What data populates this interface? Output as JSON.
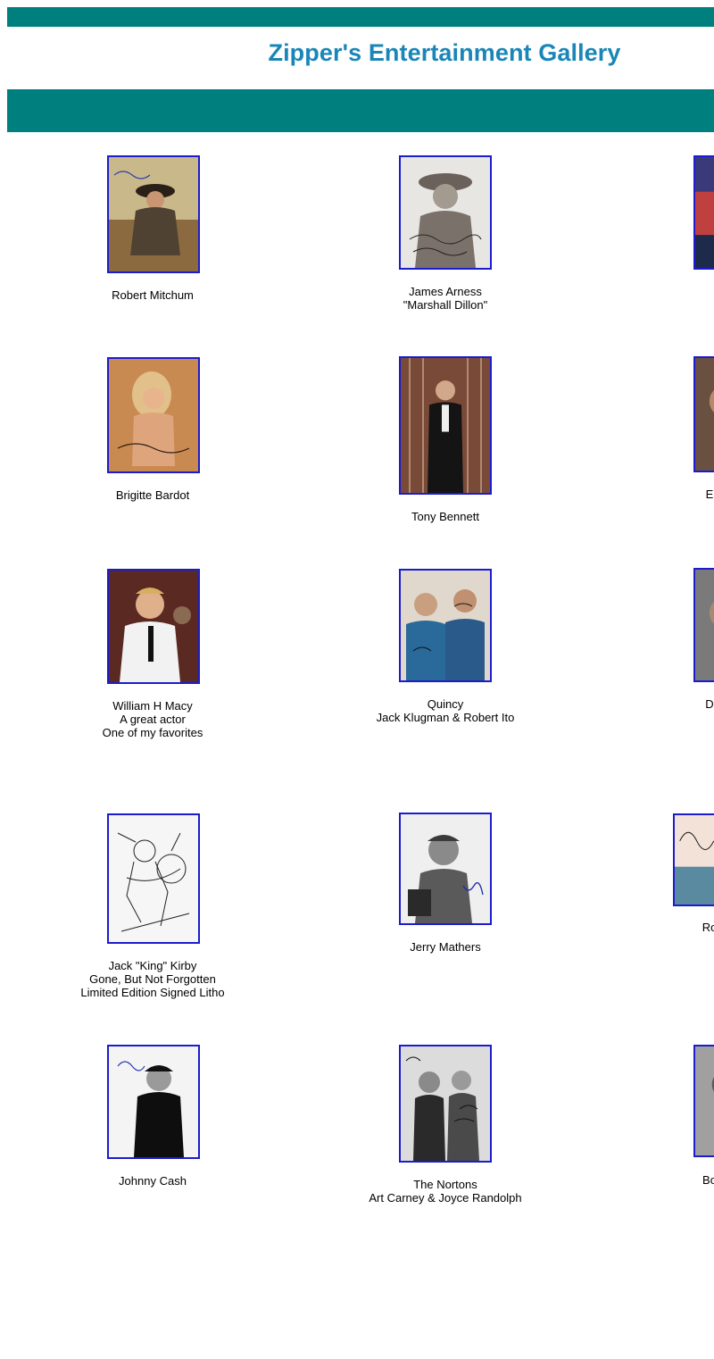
{
  "header": {
    "title": "Zipper's Entertainment Gallery"
  },
  "gallery": {
    "items": [
      {
        "caption": "Robert Mitchum"
      },
      {
        "caption": "James Arness\n\"Marshall Dillon\""
      },
      {
        "caption": ""
      },
      {
        "caption": "Brigitte Bardot"
      },
      {
        "caption": "Tony Bennett"
      },
      {
        "caption": "E"
      },
      {
        "caption": "William H Macy\nA great actor\nOne of my favorites"
      },
      {
        "caption": "Quincy\nJack Klugman & Robert Ito"
      },
      {
        "caption": "D"
      },
      {
        "caption": "Jack \"King\" Kirby\nGone, But Not Forgotten\nLimited Edition Signed Litho"
      },
      {
        "caption": "Jerry Mathers"
      },
      {
        "caption": "Ro"
      },
      {
        "caption": "Johnny Cash"
      },
      {
        "caption": "The Nortons\nArt Carney & Joyce Randolph"
      },
      {
        "caption": "Bo"
      }
    ]
  }
}
